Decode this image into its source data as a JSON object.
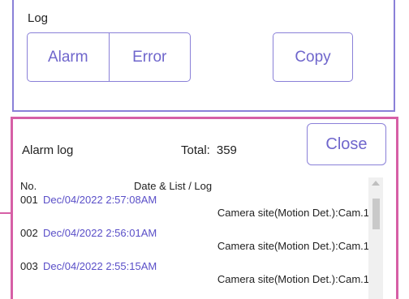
{
  "log": {
    "label": "Log",
    "alarm_button": "Alarm",
    "error_button": "Error",
    "copy_button": "Copy"
  },
  "alarm_log": {
    "title": "Alarm log",
    "total_label": "Total:",
    "total_value": "359",
    "close_button": "Close",
    "columns": {
      "no": "No.",
      "date": "Date & List / Log"
    },
    "rows": [
      {
        "no": "001",
        "date": "Dec/04/2022 2:57:08AM",
        "event": "Camera site(Motion Det.):Cam.1"
      },
      {
        "no": "002",
        "date": "Dec/04/2022 2:56:01AM",
        "event": "Camera site(Motion Det.):Cam.1"
      },
      {
        "no": "003",
        "date": "Dec/04/2022 2:55:15AM",
        "event": "Camera site(Motion Det.):Cam.1"
      }
    ]
  },
  "colors": {
    "log_panel_border": "#8a80d8",
    "alarm_panel_border": "#d65fa6",
    "accent_text": "#6f66cc",
    "date_text": "#5a4fc8"
  }
}
